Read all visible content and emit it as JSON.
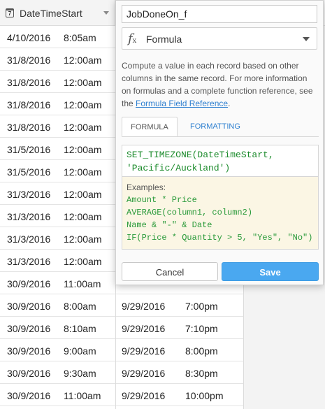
{
  "grid": {
    "column_header": "DateTimeStart",
    "column_icon": "calendar-icon",
    "calendar_day": "7",
    "rows": [
      {
        "date": "4/10/2016",
        "time": "8:05am",
        "date2": "",
        "time2": ""
      },
      {
        "date": "31/8/2016",
        "time": "12:00am",
        "date2": "",
        "time2": ""
      },
      {
        "date": "31/8/2016",
        "time": "12:00am",
        "date2": "",
        "time2": ""
      },
      {
        "date": "31/8/2016",
        "time": "12:00am",
        "date2": "",
        "time2": ""
      },
      {
        "date": "31/8/2016",
        "time": "12:00am",
        "date2": "",
        "time2": ""
      },
      {
        "date": "31/5/2016",
        "time": "12:00am",
        "date2": "",
        "time2": ""
      },
      {
        "date": "31/5/2016",
        "time": "12:00am",
        "date2": "",
        "time2": ""
      },
      {
        "date": "31/3/2016",
        "time": "12:00am",
        "date2": "",
        "time2": ""
      },
      {
        "date": "31/3/2016",
        "time": "12:00am",
        "date2": "",
        "time2": ""
      },
      {
        "date": "31/3/2016",
        "time": "12:00am",
        "date2": "",
        "time2": ""
      },
      {
        "date": "31/3/2016",
        "time": "12:00am",
        "date2": "",
        "time2": ""
      },
      {
        "date": "30/9/2016",
        "time": "11:00am",
        "date2": "",
        "time2": ""
      },
      {
        "date": "30/9/2016",
        "time": "8:00am",
        "date2": "9/29/2016",
        "time2": "7:00pm"
      },
      {
        "date": "30/9/2016",
        "time": "8:10am",
        "date2": "9/29/2016",
        "time2": "7:10pm"
      },
      {
        "date": "30/9/2016",
        "time": "9:00am",
        "date2": "9/29/2016",
        "time2": "8:00pm"
      },
      {
        "date": "30/9/2016",
        "time": "9:30am",
        "date2": "9/29/2016",
        "time2": "8:30pm"
      },
      {
        "date": "30/9/2016",
        "time": "11:00am",
        "date2": "9/29/2016",
        "time2": "10:00pm"
      }
    ]
  },
  "popup": {
    "field_name": "JobDoneOn_f",
    "field_type": "Formula",
    "field_type_icon": "formula-fx-icon",
    "description_text": "Compute a value in each record based on other columns in the same record. For more information on formulas and a complete function reference, see the ",
    "description_link": "Formula Field Reference",
    "description_end": ".",
    "tabs": [
      "FORMULA",
      "FORMATTING"
    ],
    "formula_line1": "SET_TIMEZONE(DateTimeStart,",
    "formula_line2": "'Pacific/Auckland')",
    "examples_heading": "Examples:",
    "examples": [
      "Amount * Price",
      "AVERAGE(column1, column2)",
      "Name & \"-\" & Date",
      "IF(Price * Quantity > 5, \"Yes\", \"No\")"
    ],
    "cancel_label": "Cancel",
    "save_label": "Save",
    "colors": {
      "link": "#2f80d0",
      "save": "#4aa8f0",
      "code": "#1a8a2a",
      "examples_bg": "#fbf6e4"
    }
  }
}
